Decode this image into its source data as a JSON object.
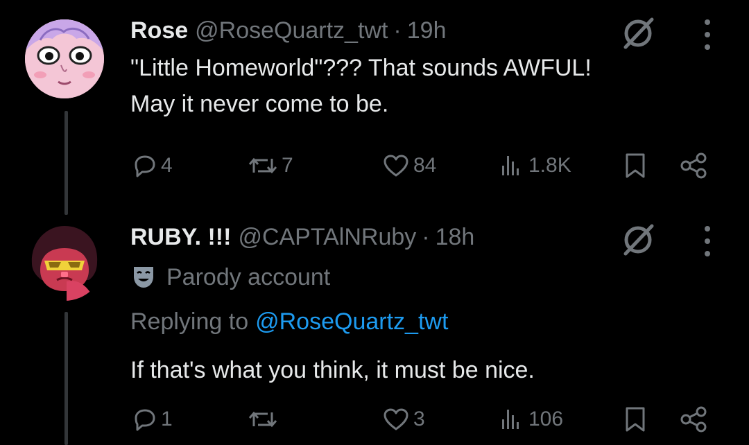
{
  "tweets": [
    {
      "display_name": "Rose",
      "handle": "@RoseQuartz_twt",
      "separator": "·",
      "time": "19h",
      "text_line1": "\"Little Homeworld\"??? That sounds AWFUL!",
      "text_line2": "May it never come to be.",
      "avatar_icon": "rose-quartz-avatar",
      "actions": {
        "replies": "4",
        "reposts": "7",
        "likes": "84",
        "views": "1.8K"
      }
    },
    {
      "display_name": "RUBY. !!!",
      "handle": "@CAPTAlNRuby",
      "separator": "·",
      "time": "18h",
      "parody_label": "Parody account",
      "replying_prefix": "Replying to",
      "replying_handle": "@RoseQuartz_twt",
      "text": "If that's what you think, it must be nice.",
      "avatar_icon": "ruby-avatar",
      "actions": {
        "replies": "1",
        "reposts": "",
        "likes": "3",
        "views": "106"
      }
    }
  ],
  "colors": {
    "background": "#000000",
    "text": "#e7e9ea",
    "muted": "#71767b",
    "link": "#1d9bf0",
    "thread_line": "#333639"
  }
}
